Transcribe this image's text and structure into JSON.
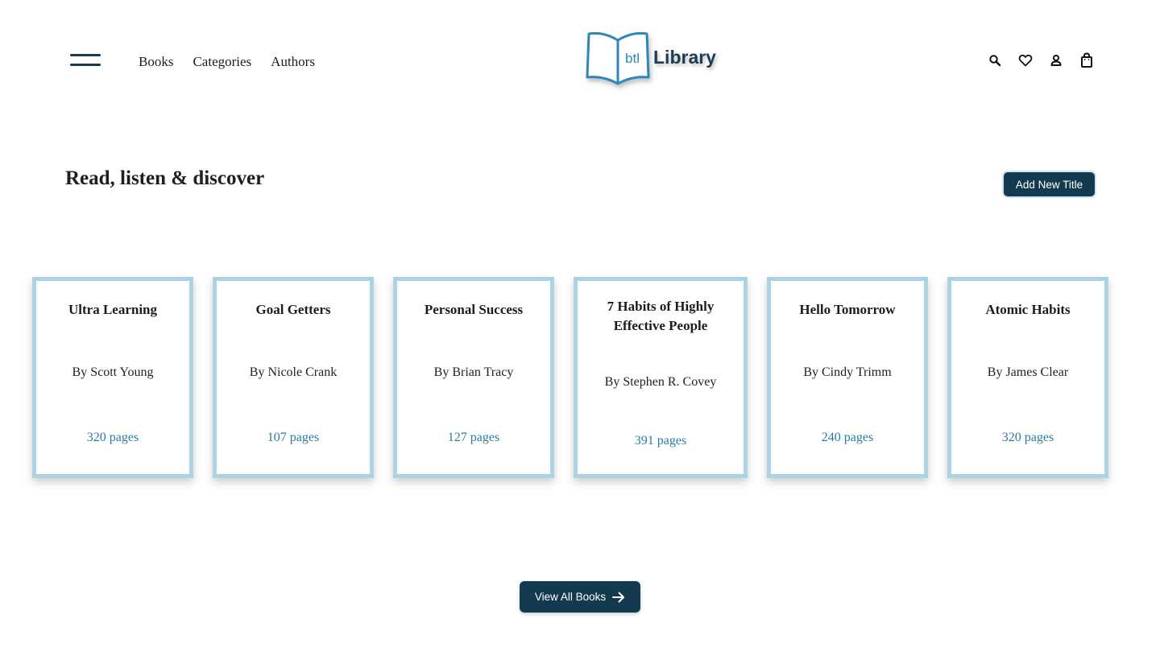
{
  "header": {
    "menu_icon": "hamburger-menu-icon",
    "nav": [
      "Books",
      "Categories",
      "Authors"
    ],
    "logo": {
      "mark": "btl",
      "text": "Library"
    },
    "icons": [
      "search-icon",
      "heart-icon",
      "user-icon",
      "shopping-bag-icon"
    ]
  },
  "main": {
    "section_title": "Read, listen & discover",
    "add_button_label": "Add New Title",
    "books": [
      {
        "title": "Ultra Learning",
        "author": "By Scott Young",
        "pages": "320 pages"
      },
      {
        "title": "Goal Getters",
        "author": "By Nicole Crank",
        "pages": "107 pages"
      },
      {
        "title": "Personal Success",
        "author": "By Brian Tracy",
        "pages": "127 pages"
      },
      {
        "title": "7 Habits of Highly Effective People",
        "author": "By Stephen R. Covey",
        "pages": "391 pages"
      },
      {
        "title": "Hello Tomorrow",
        "author": "By Cindy Trimm",
        "pages": "240 pages"
      },
      {
        "title": "Atomic Habits",
        "author": "By James Clear",
        "pages": "320 pages"
      }
    ],
    "view_all_label": "View All Books",
    "view_all_icon": "arrow-right-icon"
  },
  "colors": {
    "primary": "#133a4f",
    "card_border": "#abd3e4",
    "pages_text": "#2a7ca8",
    "logo_blue": "#2f86b8"
  }
}
